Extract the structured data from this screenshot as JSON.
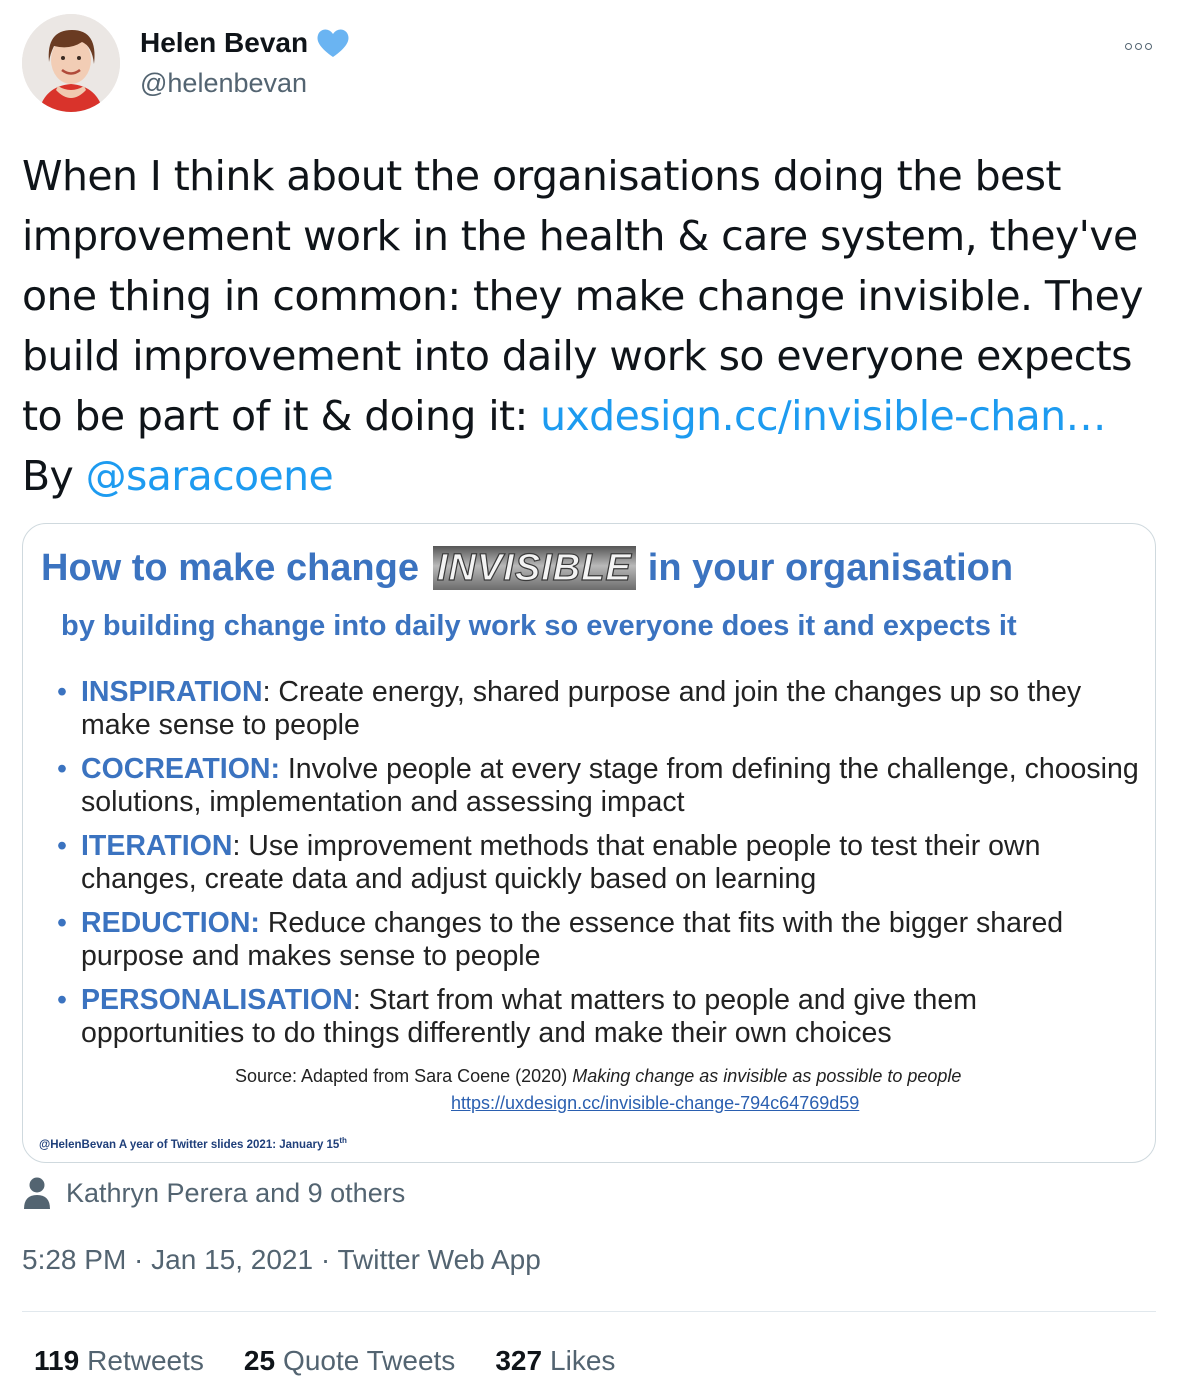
{
  "author": {
    "display_name": "Helen Bevan",
    "handle": "@helenbevan",
    "verified_color": "#6ab4f2"
  },
  "tweet": {
    "text_part1": "When I think about the organisations doing the best improvement work in the health & care system, they've one thing in common: they make change invisible. They build improvement into daily work so everyone expects to be part of it & doing it: ",
    "link_text": "uxdesign.cc/invisible-chan…",
    "text_part2": "By ",
    "mention": "@saracoene"
  },
  "slide": {
    "title_before": "How to make change",
    "title_highlight": "INVISIBLE",
    "title_after": "in your organisation",
    "subtitle": "by building change into daily work so everyone does it and expects it",
    "bullets": [
      {
        "term": "INSPIRATION",
        "sep": ":",
        "text": " Create energy, shared purpose and join the changes up so they make sense to people"
      },
      {
        "term": "COCREATION:",
        "sep": "",
        "text": " Involve people at every stage from defining the challenge, choosing solutions, implementation and assessing impact"
      },
      {
        "term": "ITERATION",
        "sep": ":",
        "text": " Use improvement methods that enable people to test their own changes, create data and adjust quickly based on learning"
      },
      {
        "term": "REDUCTION:",
        "sep": "",
        "text": " Reduce changes to the essence that fits with the bigger shared purpose and makes sense to people"
      },
      {
        "term": "PERSONALISATION",
        "sep": ":",
        "text": " Start from what matters to people and give them opportunities to do things differently and make their own choices"
      }
    ],
    "source_prefix": "Source: Adapted from Sara Coene (2020) ",
    "source_title": "Making change as invisible as possible to people",
    "source_link": "https://uxdesign.cc/invisible-change-794c64769d59",
    "credit": "@HelenBevan A year of Twitter slides 2021: January 15",
    "credit_sup": "th",
    "accent_color": "#3b73c0"
  },
  "likers": {
    "text": "Kathryn Perera and 9 others",
    "icon": "person-icon"
  },
  "meta": {
    "text": "5:28 PM · Jan 15, 2021 · Twitter Web App"
  },
  "stats": {
    "retweets_count": "119",
    "retweets_label": "Retweets",
    "quotes_count": "25",
    "quotes_label": "Quote Tweets",
    "likes_count": "327",
    "likes_label": "Likes"
  }
}
